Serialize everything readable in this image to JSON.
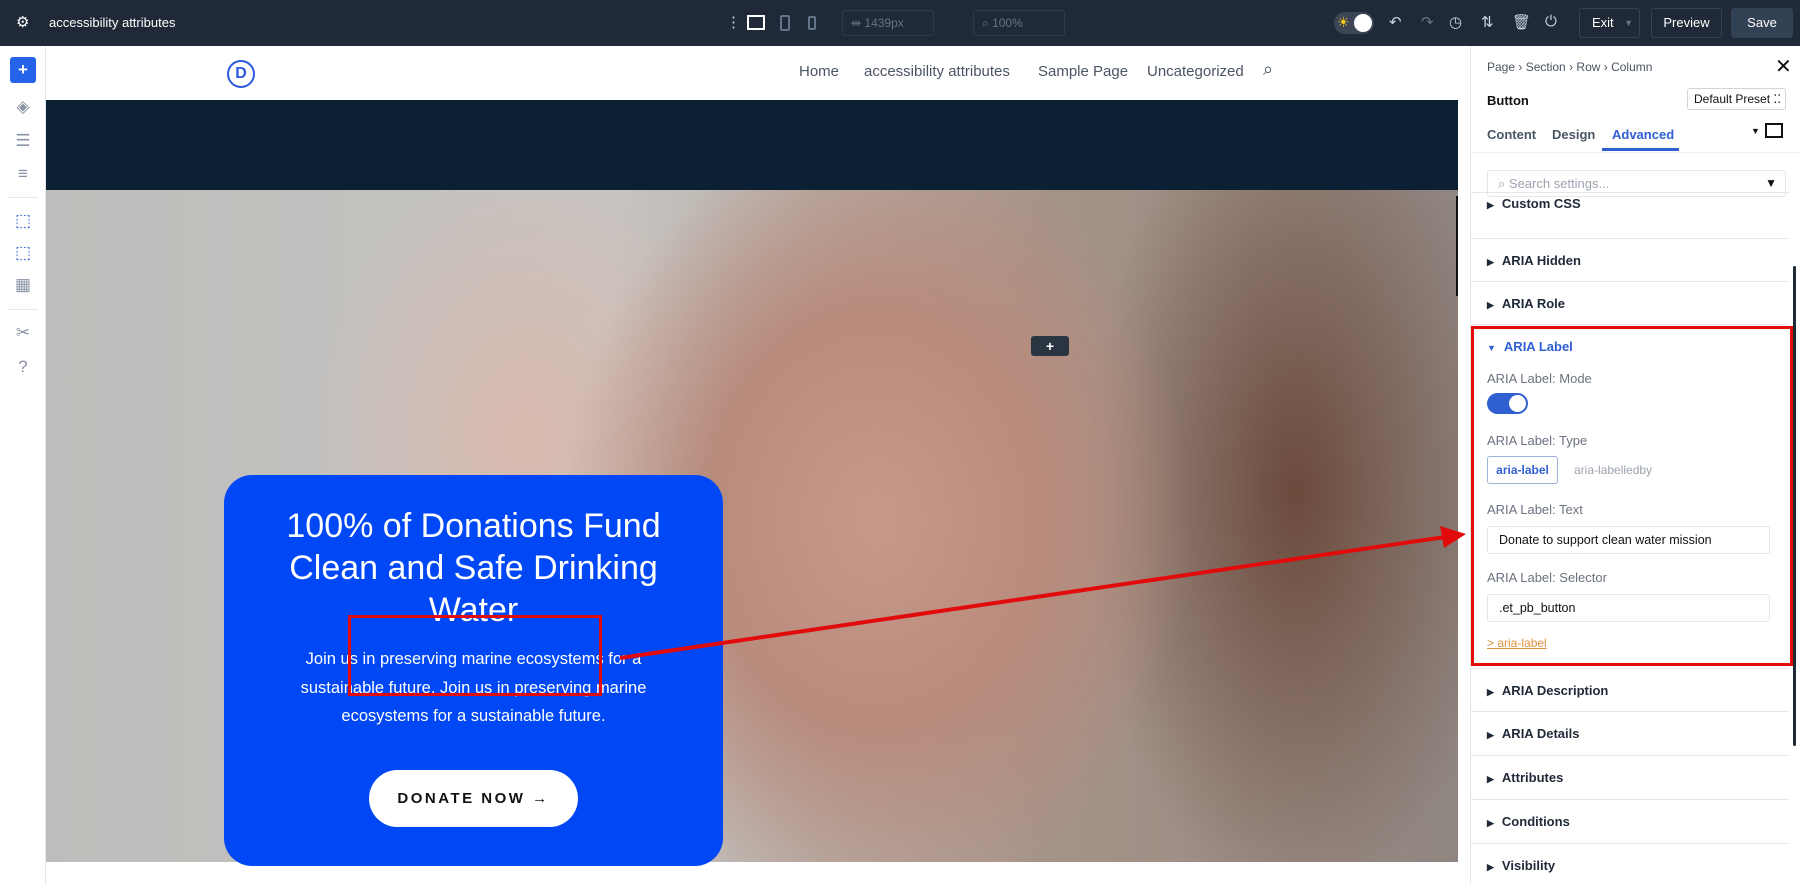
{
  "topbar": {
    "title": "accessibility attributes",
    "width_value": "1439px",
    "zoom_value": "100%",
    "exit_label": "Exit",
    "preview_label": "Preview",
    "save_label": "Save"
  },
  "site": {
    "logo_letter": "D",
    "nav": [
      "Home",
      "accessibility attributes",
      "Sample Page",
      "Uncategorized"
    ],
    "hero_heading": "100% of Donations Fund Clean and Safe Drinking Water",
    "hero_text": "Join us in preserving marine ecosystems for a sustainable future. Join us in preserving marine ecosystems for a sustainable future.",
    "button_label": "DONATE NOW",
    "button_arrow": "→",
    "add_label": "+"
  },
  "panel": {
    "breadcrumb": [
      "Page",
      "Section",
      "Row",
      "Column"
    ],
    "element_title": "Button",
    "preset_label": "Default Preset",
    "tabs": [
      "Content",
      "Design",
      "Advanced"
    ],
    "active_tab": "Advanced",
    "search_placeholder": "Search settings...",
    "rows_before": [
      "Custom CSS",
      "ARIA Hidden",
      "ARIA Role"
    ],
    "open_group": {
      "title": "ARIA Label",
      "mode_label": "ARIA Label: Mode",
      "mode_on": true,
      "type_label": "ARIA Label: Type",
      "type_options": [
        "aria-label",
        "aria-labelledby"
      ],
      "type_selected": "aria-label",
      "text_label": "ARIA Label: Text",
      "text_value": "Donate to support clean water mission",
      "selector_label": "ARIA Label: Selector",
      "selector_value": ".et_pb_button",
      "link_text": "> aria-label"
    },
    "rows_after": [
      "ARIA Description",
      "ARIA Details",
      "Attributes",
      "Conditions",
      "Visibility"
    ]
  },
  "colors": {
    "accent": "#2f5fd0",
    "annotation": "#e10b0b",
    "card": "#0048f5",
    "topbar": "#1f2937"
  }
}
